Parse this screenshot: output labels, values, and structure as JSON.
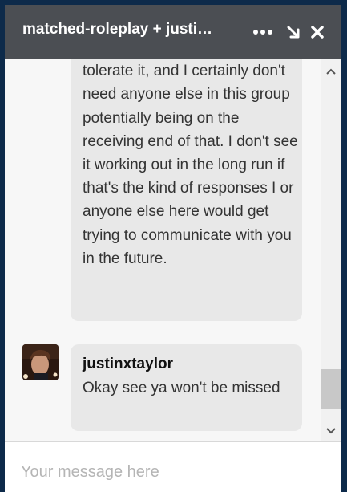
{
  "chat": {
    "title": "matched-roleplay + justi…",
    "messages": [
      {
        "text": "uncalled for. I don't need to tolerate it, and I certainly don't need anyone else in this group potentially being on the receiving end of that. I don't see it working out in the long run if that's the kind of responses I or anyone else here would get trying to communicate with you in the future."
      },
      {
        "author": "justinxtaylor",
        "text": "Okay see ya won't be missed"
      }
    ],
    "composer": {
      "placeholder": "Your message here"
    }
  },
  "icons": {
    "more": "ellipsis-icon",
    "minimize": "minimize-arrow-icon",
    "close": "close-icon",
    "scroll_up": "chevron-up-icon",
    "scroll_down": "chevron-down-icon"
  },
  "colors": {
    "header_bg": "#4b4e53",
    "bubble_bg": "#e8e8e8",
    "page_bg": "#0d2a4a"
  }
}
